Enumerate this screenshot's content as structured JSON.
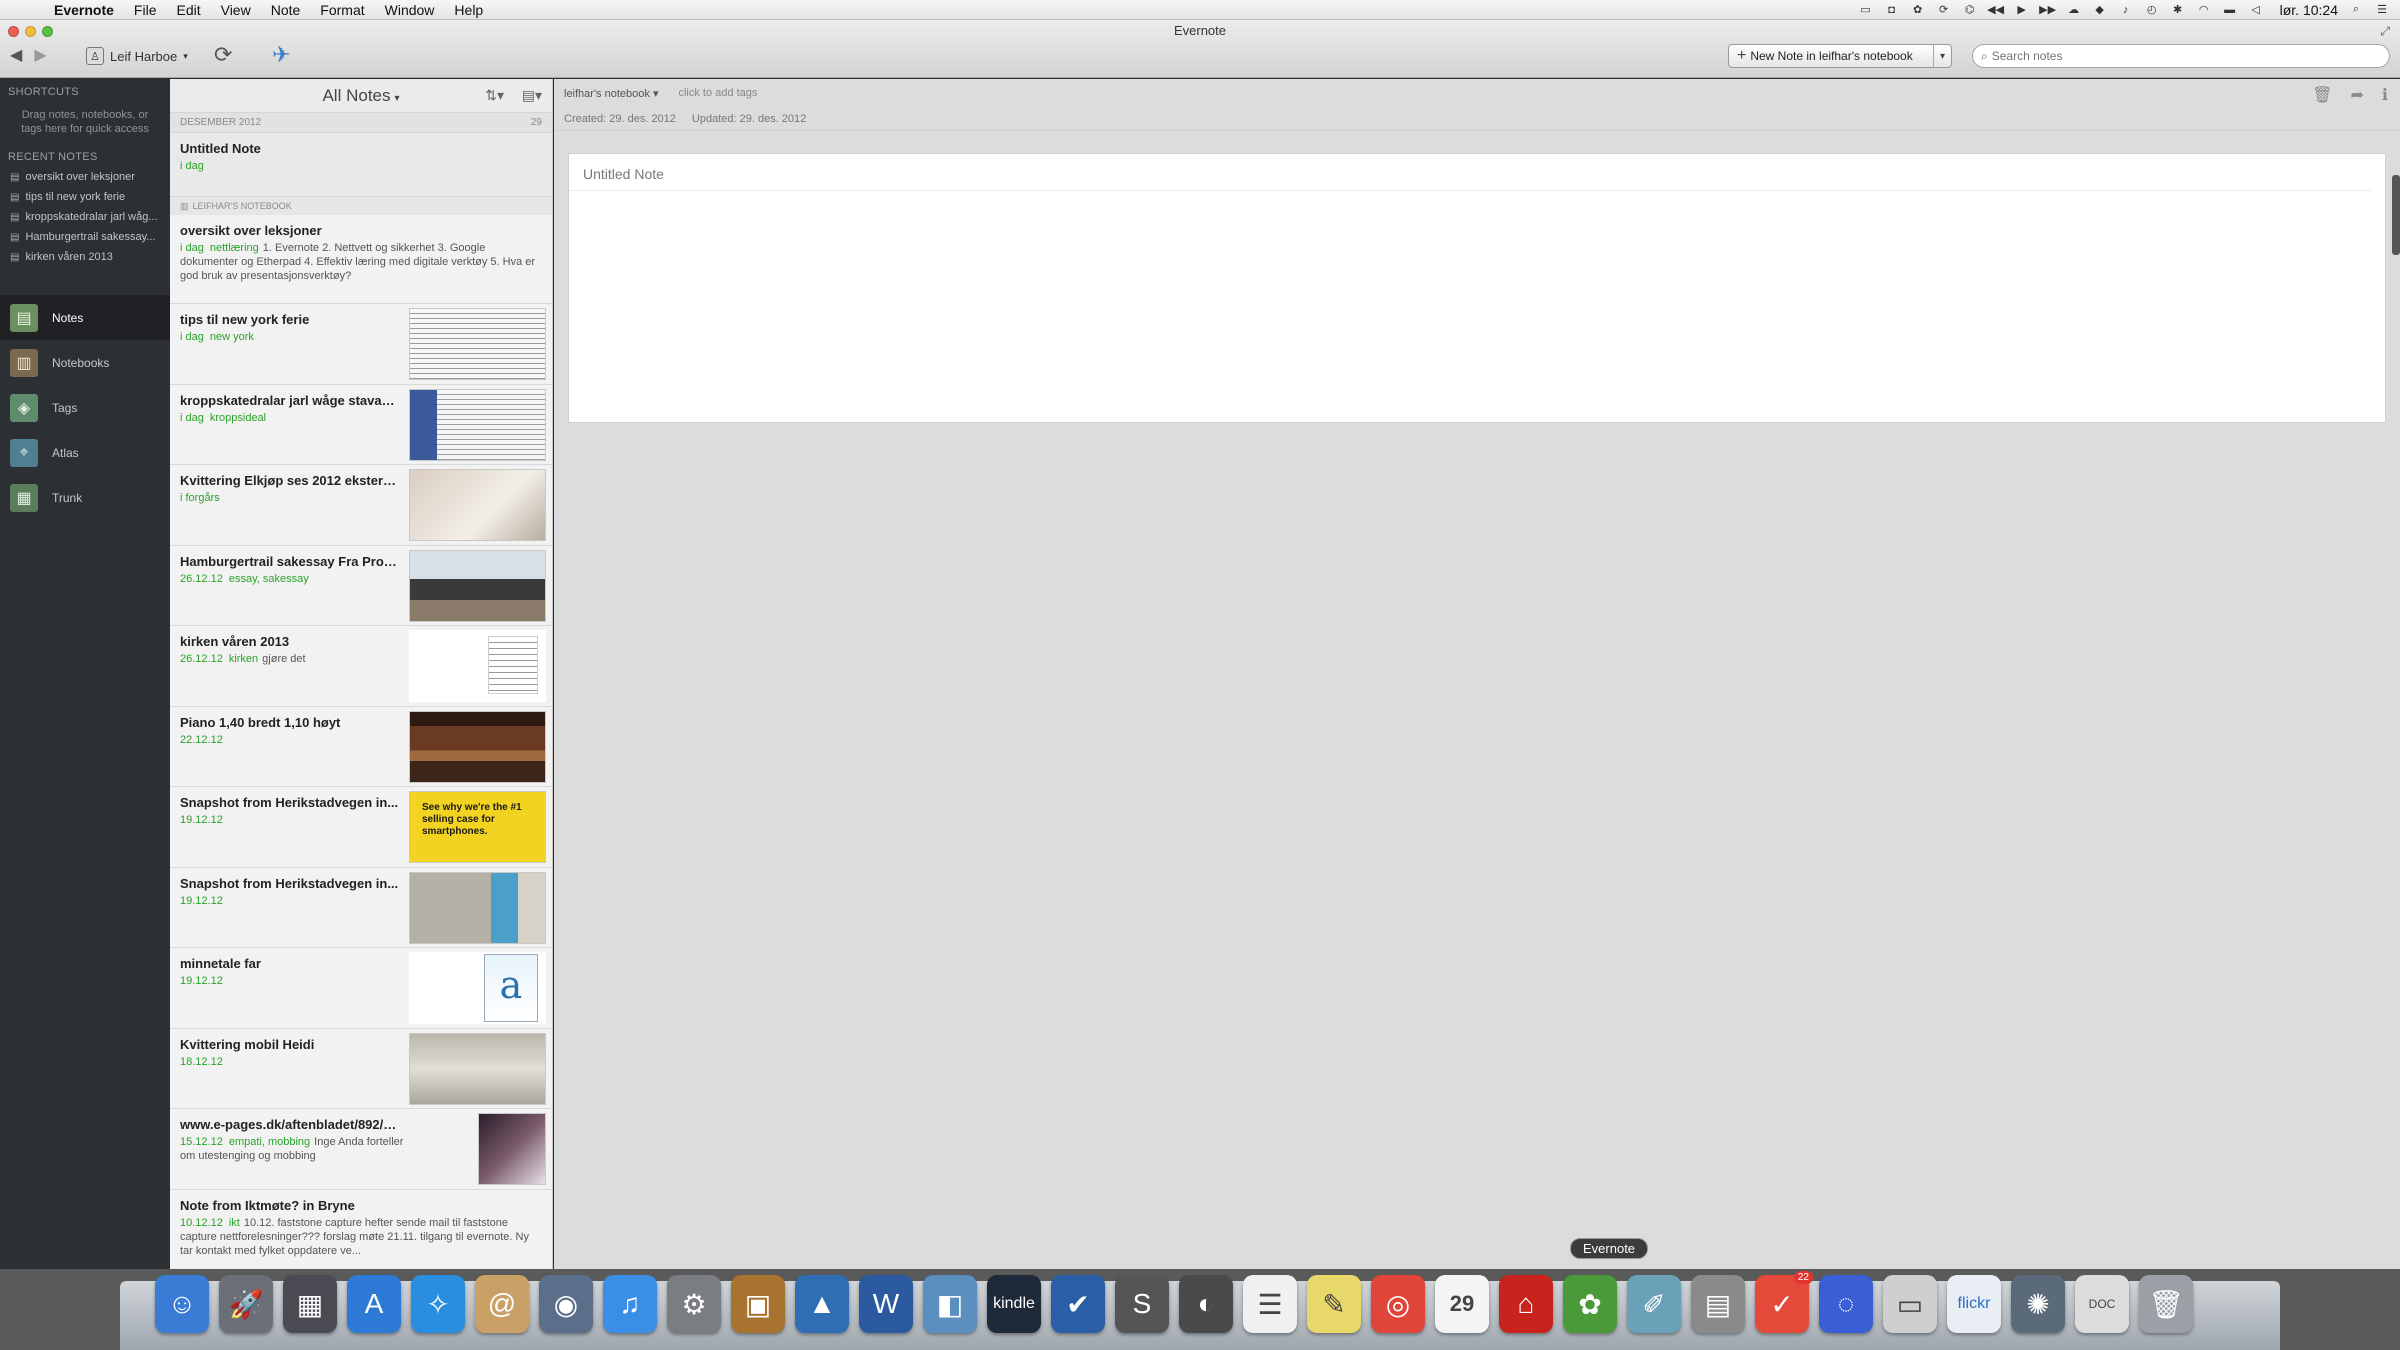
{
  "menubar": {
    "app_name": "Evernote",
    "menus": [
      "File",
      "Edit",
      "View",
      "Note",
      "Format",
      "Window",
      "Help"
    ],
    "clock": "lør. 10:24"
  },
  "window": {
    "title": "Evernote"
  },
  "toolbar": {
    "account_name": "Leif Harboe",
    "new_note_label": "New Note in leifhar's notebook",
    "search_placeholder": "Search notes"
  },
  "sidebar": {
    "shortcuts_heading": "SHORTCUTS",
    "shortcuts_hint": "Drag notes, notebooks, or tags here for quick access",
    "recent_heading": "RECENT NOTES",
    "recent_notes": [
      "oversikt over leksjoner",
      "tips til new york ferie",
      "kroppskatedralar jarl wåg...",
      "Hamburgertrail sakessay...",
      "kirken våren 2013"
    ],
    "nav": [
      {
        "label": "Notes",
        "icon": "notes-icon"
      },
      {
        "label": "Notebooks",
        "icon": "notebooks-icon"
      },
      {
        "label": "Tags",
        "icon": "tags-icon"
      },
      {
        "label": "Atlas",
        "icon": "atlas-icon"
      },
      {
        "label": "Trunk",
        "icon": "trunk-icon"
      }
    ]
  },
  "notelist": {
    "header": "All Notes",
    "section_label": "DESEMBER 2012",
    "section_count": "29",
    "notebook_label": "LEIFHAR'S NOTEBOOK",
    "notes": [
      {
        "title": "Untitled Note",
        "date": "i dag",
        "tags": "",
        "snippet": ""
      },
      {
        "title": "oversikt over leksjoner",
        "date": "i dag",
        "tags": "nettlæring",
        "snippet": "1. Evernote 2. Nettvett og sikkerhet 3. Google dokumenter og Etherpad 4. Effektiv læring med digitale verktøy 5. Hva er god bruk av presentasjonsverktøy?"
      },
      {
        "title": "tips til new york ferie",
        "date": "i dag",
        "tags": "new york",
        "snippet": ""
      },
      {
        "title": "kroppskatedralar jarl wåge stavan...",
        "date": "i dag",
        "tags": "kroppsideal",
        "snippet": ""
      },
      {
        "title": "Kvittering Elkjøp ses 2012 ekstern...",
        "date": "i forgårs",
        "tags": "",
        "snippet": ""
      },
      {
        "title": "Hamburgertrail sakessay Fra Pros...",
        "date": "26.12.12",
        "tags": "essay, sakessay",
        "snippet": ""
      },
      {
        "title": "kirken våren 2013",
        "date": "26.12.12",
        "tags": "kirken",
        "snippet": "gjøre det"
      },
      {
        "title": "Piano 1,40 bredt 1,10 høyt",
        "date": "22.12.12",
        "tags": "",
        "snippet": ""
      },
      {
        "title": "Snapshot from Herikstadvegen in...",
        "date": "19.12.12",
        "tags": "",
        "snippet": "",
        "thumb_text": "See why we're the #1 selling case for smartphones."
      },
      {
        "title": "Snapshot from Herikstadvegen in...",
        "date": "19.12.12",
        "tags": "",
        "snippet": ""
      },
      {
        "title": "minnetale far",
        "date": "19.12.12",
        "tags": "",
        "snippet": "",
        "thumb_text": "a"
      },
      {
        "title": "Kvittering mobil Heidi",
        "date": "18.12.12",
        "tags": "",
        "snippet": ""
      },
      {
        "title": "www.e-pages.dk/aftenbladet/892/scripts/?m...",
        "date": "15.12.12",
        "tags": "empati, mobbing",
        "snippet": "Inge Anda forteller om utestenging og mobbing"
      },
      {
        "title": "Note from Iktmøte? in Bryne",
        "date": "10.12.12",
        "tags": "ikt",
        "snippet": "10.12. faststone capture hefter sende mail til faststone capture nettforelesninger??? forslag møte 21.11. tilgang til evernote. Ny tar kontakt med fylket oppdatere ve..."
      }
    ]
  },
  "editor": {
    "notebook_selector": "leifhar's notebook",
    "tags_hint": "click to add tags",
    "created": "Created: 29. des. 2012",
    "updated": "Updated: 29. des. 2012",
    "note_title": "Untitled Note"
  },
  "dock": {
    "tooltip": "Evernote",
    "calendar_day": "29",
    "kindle_label": "kindle",
    "flickr_label": "flickr",
    "doc_label": "DOC",
    "badge_count": "22",
    "items": [
      {
        "name": "finder",
        "color": "#3a7bd5",
        "glyph": "☺"
      },
      {
        "name": "launchpad",
        "color": "#6a6f78",
        "glyph": "🚀"
      },
      {
        "name": "mission-control",
        "color": "#4a4a52",
        "glyph": "▦"
      },
      {
        "name": "app-store",
        "color": "#2d7ad6",
        "glyph": "A"
      },
      {
        "name": "safari",
        "color": "#2a8ee0",
        "glyph": "✧"
      },
      {
        "name": "contacts",
        "color": "#c9a066",
        "glyph": "@"
      },
      {
        "name": "iphoto",
        "color": "#5b6f8a",
        "glyph": "◉"
      },
      {
        "name": "itunes",
        "color": "#3b8ee6",
        "glyph": "♫"
      },
      {
        "name": "system-preferences",
        "color": "#7a7d82",
        "glyph": "⚙"
      },
      {
        "name": "photos",
        "color": "#a8732f",
        "glyph": "▣"
      },
      {
        "name": "keynote",
        "color": "#2f6db4",
        "glyph": "▲"
      },
      {
        "name": "word",
        "color": "#2c5aa0",
        "glyph": "W"
      },
      {
        "name": "preview",
        "color": "#5a8fc0",
        "glyph": "◧"
      },
      {
        "name": "kindle",
        "color": "#1e2a3a",
        "glyph": "K"
      },
      {
        "name": "todo",
        "color": "#2a5fa8",
        "glyph": "✔"
      },
      {
        "name": "skype",
        "color": "#555",
        "glyph": "S"
      },
      {
        "name": "facetime",
        "color": "#4a4a4a",
        "glyph": "◐"
      },
      {
        "name": "reminders",
        "color": "#f0f0f0",
        "glyph": "☰"
      },
      {
        "name": "stickies",
        "color": "#e8d86a",
        "glyph": "✎"
      },
      {
        "name": "chrome",
        "color": "#e0453a",
        "glyph": "◎"
      },
      {
        "name": "ical",
        "color": "#f4f4f4",
        "glyph": "29"
      },
      {
        "name": "acrobat",
        "color": "#c9231e",
        "glyph": "⌂"
      },
      {
        "name": "evernote",
        "color": "#4a9a3a",
        "glyph": "✿"
      },
      {
        "name": "scrivener",
        "color": "#6aa0b8",
        "glyph": "✐"
      },
      {
        "name": "calculator",
        "color": "#8a8a8a",
        "glyph": "▤"
      },
      {
        "name": "wunderlist",
        "color": "#e34a3a",
        "glyph": "✓"
      },
      {
        "name": "uplink",
        "color": "#3a5fd5",
        "glyph": "◌"
      },
      {
        "name": "scanner",
        "color": "#cfcfcf",
        "glyph": "▭"
      },
      {
        "name": "flickr-uploadr",
        "color": "#e8eef4",
        "glyph": "⇧"
      },
      {
        "name": "imovie",
        "color": "#5a6a7a",
        "glyph": "✺"
      },
      {
        "name": "documents-stack",
        "color": "#dcdcdc",
        "glyph": "▯"
      },
      {
        "name": "trash",
        "color": "#9aa0a6",
        "glyph": "🗑"
      }
    ]
  }
}
